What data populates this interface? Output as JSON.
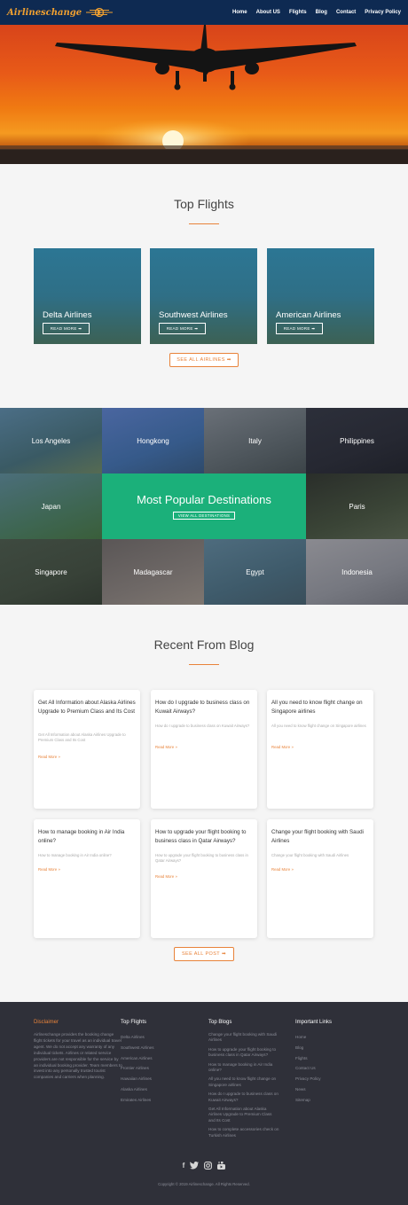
{
  "header": {
    "logo_text": "Airlineschange",
    "nav": [
      "Home",
      "About US",
      "Flights",
      "Blog",
      "Contact",
      "Privacy Policy"
    ]
  },
  "top_flights": {
    "title": "Top Flights",
    "cards": [
      {
        "name": "Delta Airlines",
        "button": "READ MORE"
      },
      {
        "name": "Southwest Airlines",
        "button": "READ MORE"
      },
      {
        "name": "American Airlines",
        "button": "READ MORE"
      }
    ],
    "see_all": "SEE ALL AIRLINES"
  },
  "destinations": {
    "row1": [
      "Los Angeles",
      "Hongkong",
      "Italy",
      "Philippines"
    ],
    "row2_left": "Japan",
    "row2_right": "Paris",
    "row3": [
      "Singapore",
      "Madagascar",
      "Egypt",
      "Indonesia"
    ],
    "feature_title": "Most Popular Destinations",
    "feature_button": "VIEW ALL DESTINATIONS"
  },
  "blog": {
    "title": "Recent From Blog",
    "posts": [
      {
        "title": "Get All Information about Alaska Airlines Upgrade to Premium Class and Its Cost",
        "excerpt": "Get All Information about Alaska Airlines Upgrade to Premium Class and Its Cost",
        "more": "Read More »"
      },
      {
        "title": "How do I upgrade to business class on Kuwait Airways?",
        "excerpt": "How do I upgrade to business class on Kuwait Airways?",
        "more": "Read More »"
      },
      {
        "title": "All you need to know flight change on Singapore airlines",
        "excerpt": "All you need to know flight change on Singapore airlines",
        "more": "Read More »"
      },
      {
        "title": "How to manage booking in Air India online?",
        "excerpt": "How to manage booking in Air India online?",
        "more": "Read More »"
      },
      {
        "title": "How to upgrade your flight booking to business class in Qatar Airways?",
        "excerpt": "How to upgrade your flight booking to business class in Qatar Airways?",
        "more": "Read More »"
      },
      {
        "title": "Change your flight booking with Saudi Airlines",
        "excerpt": "Change your flight booking with Saudi Airlines",
        "more": "Read More »"
      }
    ],
    "see_all": "SEE ALL POST"
  },
  "footer": {
    "about_title": "Disclaimer",
    "about_text": "Airlineschange provides the booking change flight tickets for your travel as an individual travel agent. We do not accept any warranty of any individual tickets. Airlines or related service providers are not responsible for the service by an individual booking provider. Team members to invest into any personally trusted tourist companies and carriers when planning.",
    "col2_title": "Top Flights",
    "col2_items": [
      "Delta Airlines",
      "Southwest Airlines",
      "American Airlines",
      "Frontier Airlines",
      "Hawaiian Airlines",
      "Alaska Airlines",
      "Emirates Airlines"
    ],
    "col3_title": "Top Blogs",
    "col3_items": [
      "Change your flight booking with Saudi Airlines",
      "How to upgrade your flight booking to business class in Qatar Airways?",
      "How to manage booking in Air India online?",
      "All you need to know flight change on Singapore airlines",
      "How do I upgrade to business class on Kuwait Airways?",
      "Get All Information about Alaska Airlines Upgrade to Premium Class and Its Cost",
      "How to complete accessories check on Turkish Airlines"
    ],
    "col4_title": "Important Links",
    "col4_items": [
      "Home",
      "Blog",
      "Flights",
      "Contact Us",
      "Privacy Policy",
      "News",
      "Sitemap"
    ],
    "social": [
      "f",
      "t",
      "ig",
      "yt"
    ],
    "copyright": "Copyright © 2019 Airlineschange. All Rights Reserved."
  },
  "colors": {
    "header": "#0e2a52",
    "accent": "#e8833a",
    "feature": "#1bb07a",
    "footer": "#2f3039"
  }
}
